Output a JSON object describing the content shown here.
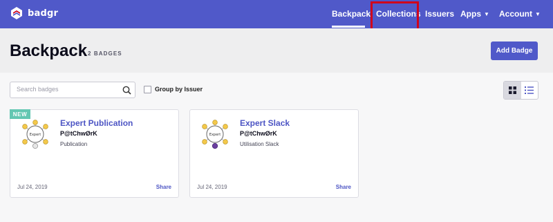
{
  "app": {
    "name": "badgr"
  },
  "nav": {
    "backpack": "Backpack",
    "collections": "Collections",
    "issuers": "Issuers",
    "apps": "Apps",
    "account": "Account"
  },
  "header": {
    "title": "Backpack",
    "count": "2 BADGES",
    "add_button": "Add Badge"
  },
  "toolbar": {
    "search_placeholder": "Search badges",
    "group_label": "Group by Issuer"
  },
  "badges": [
    {
      "tag": "NEW",
      "title": "Expert Publication",
      "issuer": "P@tChwØrK",
      "description": "Publication",
      "date": "Jul 24, 2019",
      "share": "Share"
    },
    {
      "tag": "",
      "title": "Expert Slack",
      "issuer": "P@tChwØrK",
      "description": "Utilisation Slack",
      "date": "Jul 24, 2019",
      "share": "Share"
    }
  ],
  "colors": {
    "brand": "#5059c9",
    "highlight": "#d0021b",
    "new_tag": "#63c7b2",
    "link": "#4d55c4"
  },
  "icons": [
    "badgr-logo-icon",
    "search-icon",
    "grid-view-icon",
    "list-view-icon",
    "caret-down-icon",
    "badge-image-icon"
  ]
}
